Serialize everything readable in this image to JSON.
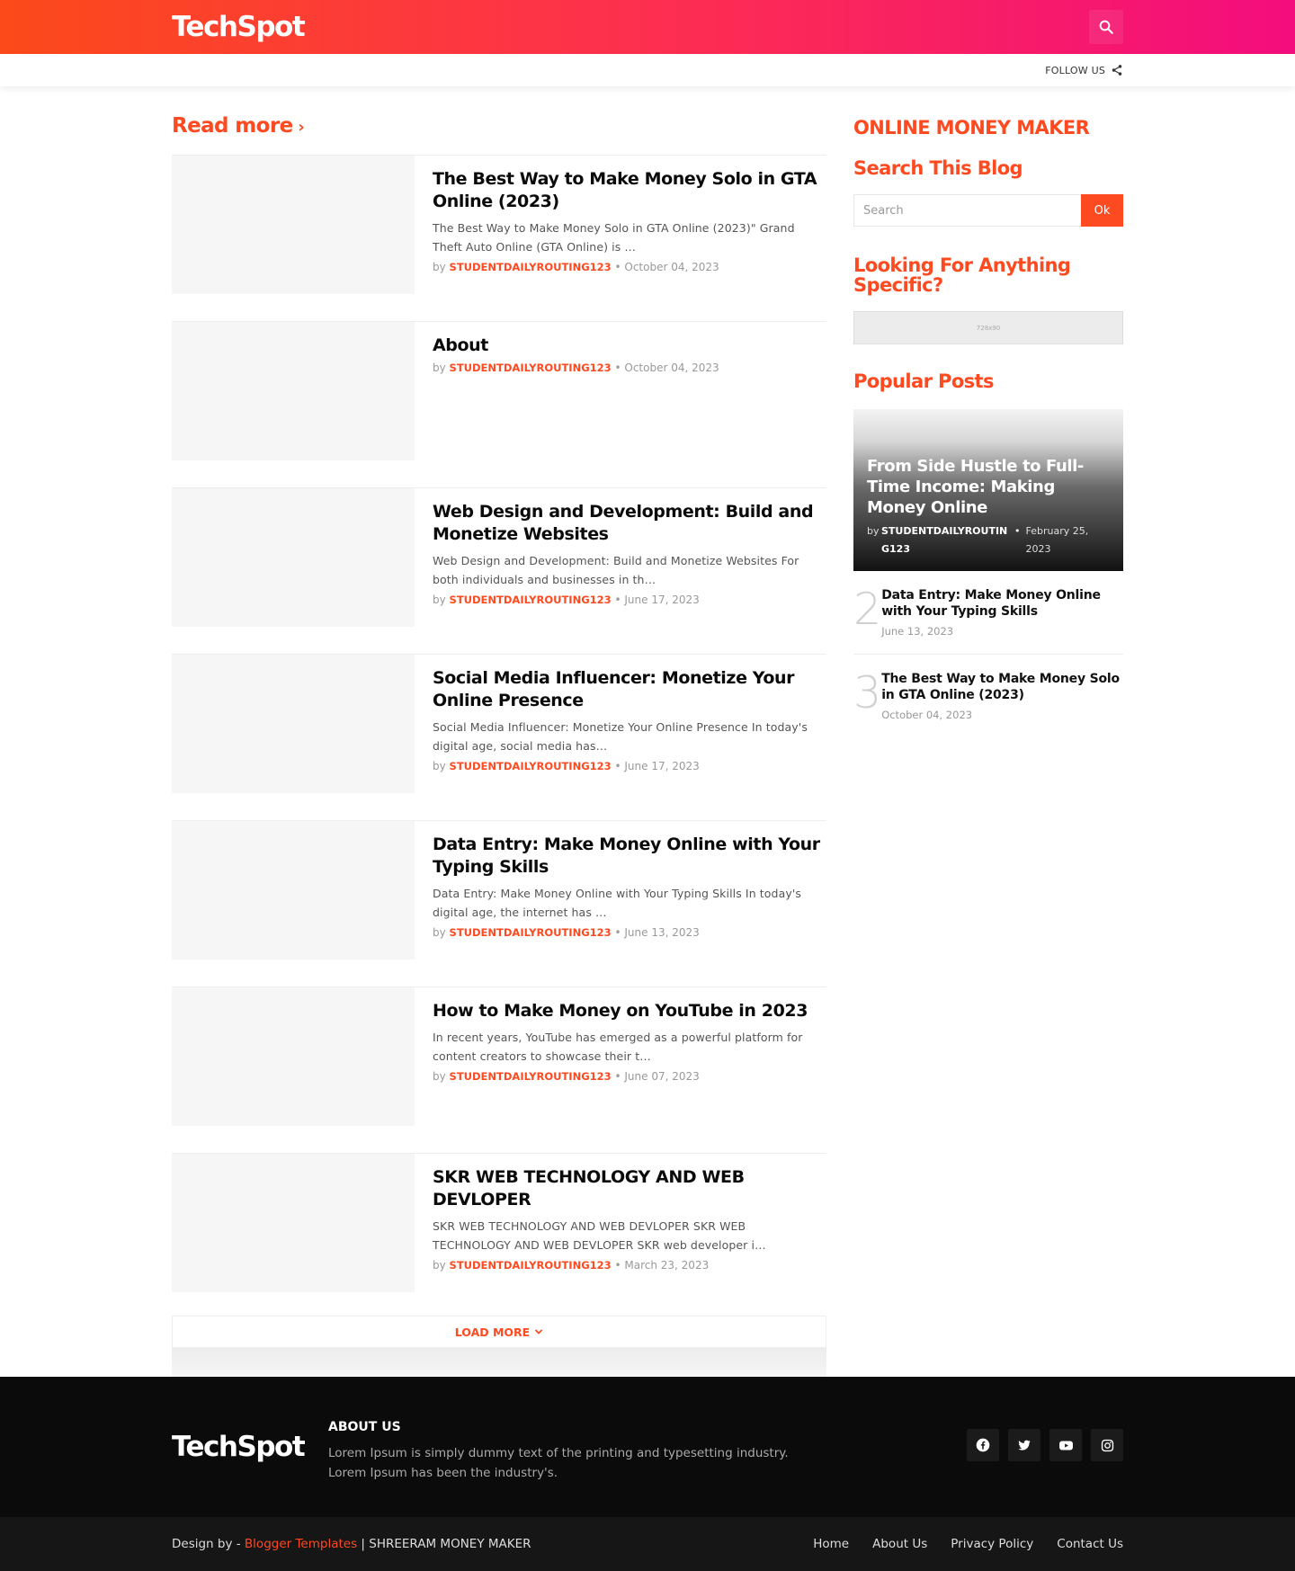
{
  "header": {
    "logo": "TechSpot",
    "search_icon": "search-icon",
    "follow_label": "FOLLOW US",
    "share_icon": "share-icon"
  },
  "main": {
    "section_title": "Read more",
    "posts": [
      {
        "title": "The Best Way to Make Money Solo in GTA Online (2023)",
        "snippet": "The Best Way to Make Money Solo in GTA Online (2023)\" Grand Theft Auto Online (GTA Online) is …",
        "by": "by",
        "author": "STUDENTDAILYROUTING123",
        "date": "October 04, 2023"
      },
      {
        "title": "About",
        "snippet": "",
        "by": "by",
        "author": "STUDENTDAILYROUTING123",
        "date": "October 04, 2023"
      },
      {
        "title": "Web Design and Development: Build and Monetize Websites",
        "snippet": "Web Design and Development: Build and Monetize Websites   For both individuals and businesses in th…",
        "by": "by",
        "author": "STUDENTDAILYROUTING123",
        "date": "June 17, 2023"
      },
      {
        "title": "Social Media Influencer: Monetize Your Online Presence",
        "snippet": "Social Media Influencer: Monetize Your Online Presence In today's digital age, social media has…",
        "by": "by",
        "author": "STUDENTDAILYROUTING123",
        "date": "June 17, 2023"
      },
      {
        "title": "Data Entry: Make Money Online with Your Typing Skills",
        "snippet": "Data Entry: Make Money Online with Your Typing Skills In today's digital age, the internet has …",
        "by": "by",
        "author": "STUDENTDAILYROUTING123",
        "date": "June 13, 2023"
      },
      {
        "title": "How to Make Money on YouTube in 2023",
        "snippet": "In recent years, YouTube has emerged as a powerful platform for content creators to showcase their t…",
        "by": "by",
        "author": "STUDENTDAILYROUTING123",
        "date": "June 07, 2023"
      },
      {
        "title": "SKR WEB TECHNOLOGY AND WEB DEVLOPER",
        "snippet": "SKR WEB TECHNOLOGY AND WEB DEVLOPER SKR WEB TECHNOLOGY AND WEB DEVLOPER SKR web developer i…",
        "by": "by",
        "author": "STUDENTDAILYROUTING123",
        "date": "March 23, 2023"
      }
    ],
    "load_more": "LOAD MORE"
  },
  "sidebar": {
    "online_title": "ONLINE MONEY MAKER",
    "search_title": "Search This Blog",
    "search_placeholder": "Search",
    "search_button": "Ok",
    "looking_title": "Looking For Anything Specific?",
    "ad_label": "728x90",
    "popular_title": "Popular Posts",
    "featured": {
      "title": "From Side Hustle to Full-Time Income: Making Money Online",
      "by": "by",
      "author": "STUDENTDAILYROUTING123",
      "date": "February 25, 2023"
    },
    "popular": [
      {
        "num": "2",
        "title": "Data Entry: Make Money Online with Your Typing Skills",
        "date": "June 13, 2023"
      },
      {
        "num": "3",
        "title": "The Best Way to Make Money Solo in GTA Online (2023)",
        "date": "October 04, 2023"
      }
    ]
  },
  "footer": {
    "logo": "TechSpot",
    "about_title": "ABOUT US",
    "about_text": "Lorem Ipsum is simply dummy text of the printing and typesetting industry. Lorem Ipsum has been the industry's.",
    "socials": [
      "facebook-icon",
      "twitter-icon",
      "youtube-icon",
      "instagram-icon"
    ],
    "credits_prefix": "Design by - ",
    "credits_link": "Blogger Templates",
    "credits_suffix": " | SHREERAM MONEY MAKER",
    "menu": [
      "Home",
      "About Us",
      "Privacy Policy",
      "Contact Us"
    ]
  },
  "colors": {
    "accent": "#fd4a20",
    "header_gradient_start": "#fc4a1a",
    "header_gradient_end": "#f30d7d",
    "footer_bg": "#0b0b0b"
  }
}
